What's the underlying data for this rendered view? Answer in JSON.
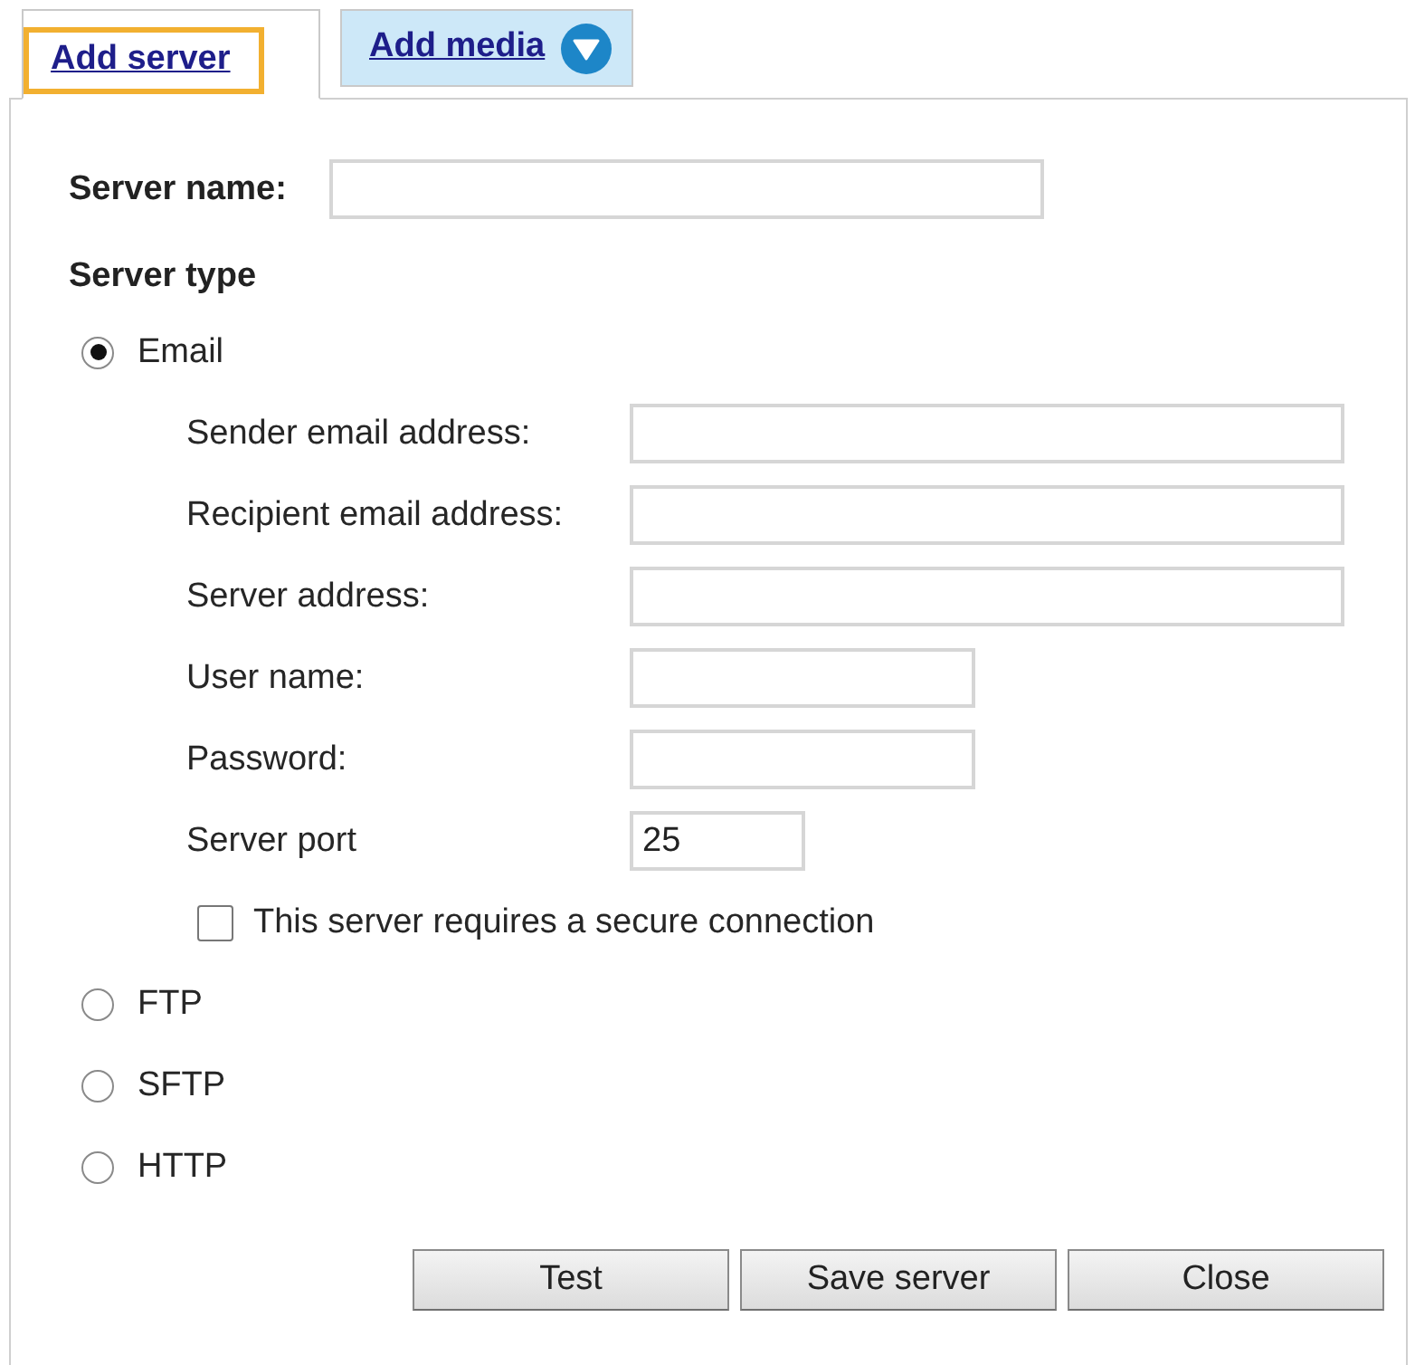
{
  "tabs": [
    {
      "label": "Add server",
      "selected": true,
      "focused": true,
      "dropdown": false
    },
    {
      "label": "Add media",
      "selected": false,
      "focused": false,
      "dropdown": true
    }
  ],
  "server_name": {
    "label": "Server name:"
  },
  "server_type": {
    "heading": "Server type",
    "options": [
      {
        "label": "Email",
        "selected": true,
        "fields": [
          {
            "kind": "email",
            "label": "Sender email address:"
          },
          {
            "kind": "email",
            "label": "Recipient email address:"
          },
          {
            "kind": "host",
            "label": "Server address:"
          },
          {
            "kind": "user",
            "label": "User name:"
          },
          {
            "kind": "password",
            "label": "Password:"
          },
          {
            "kind": "port",
            "label": "Server port",
            "value": "25"
          }
        ],
        "secure_connection": {
          "label": "This server requires a secure connection",
          "checked": false
        }
      },
      {
        "label": "FTP",
        "selected": false
      },
      {
        "label": "SFTP",
        "selected": false
      },
      {
        "label": "HTTP",
        "selected": false
      }
    ]
  },
  "buttons": [
    "Test",
    "Save server",
    "Close"
  ]
}
